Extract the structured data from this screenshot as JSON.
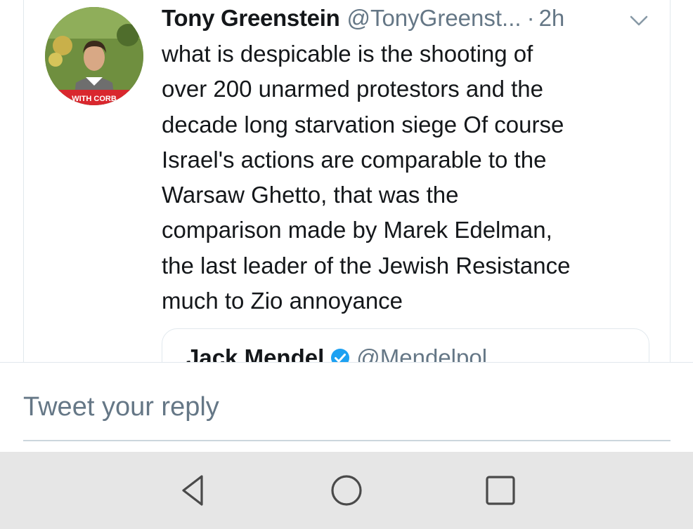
{
  "tweet": {
    "author_name": "Tony Greenstein",
    "author_handle": "@TonyGreenst...",
    "separator": "·",
    "time_ago": "2h",
    "avatar_caption": "WITH CORB",
    "caret_icon": "chevron-down-icon",
    "lines": [
      "what is despicable is the shooting of",
      "over 200 unarmed protestors and the",
      "decade long starvation siege Of course",
      "Israel's actions are comparable to the",
      "Warsaw Ghetto, that was the",
      "comparison made by Marek Edelman,",
      "the last leader of the Jewish Resistance",
      "much to Zio annoyance"
    ]
  },
  "quoted_tweet": {
    "author_name": "Jack Mendel",
    "verified_icon": "verified-badge-icon",
    "author_handle": "@Mendelpol"
  },
  "reply": {
    "placeholder": "Tweet your reply",
    "value": ""
  },
  "nav": {
    "back_icon": "back-triangle-icon",
    "home_icon": "home-circle-icon",
    "recents_icon": "recents-square-icon"
  },
  "colors": {
    "text": "#14171a",
    "secondary_text": "#657786",
    "border": "#e1e8ed",
    "verified_blue": "#1da1f2",
    "nav_background": "#e6e6e6"
  }
}
